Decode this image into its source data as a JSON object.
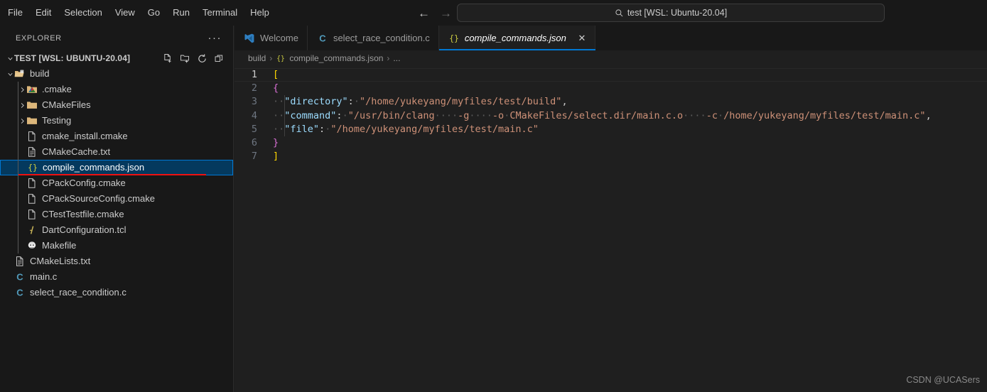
{
  "titlebar": {
    "menu": [
      "File",
      "Edit",
      "Selection",
      "View",
      "Go",
      "Run",
      "Terminal",
      "Help"
    ],
    "back_arrow": "←",
    "forward_arrow": "→",
    "command_center_text": "test [WSL: Ubuntu-20.04]",
    "search_icon": "search-icon"
  },
  "sidebar": {
    "title": "EXPLORER",
    "more_actions": "···",
    "root": {
      "label": "TEST [WSL: UBUNTU-20.04]",
      "expanded": true,
      "actions": [
        "new-file-icon",
        "new-folder-icon",
        "refresh-icon",
        "collapse-all-icon"
      ]
    },
    "tree": [
      {
        "label": "build",
        "icon": "folder-open-build",
        "indent": 1,
        "kind": "folder",
        "expanded": true,
        "selected": false
      },
      {
        "label": ".cmake",
        "icon": "folder-cmake",
        "indent": 2,
        "kind": "folder",
        "expanded": false,
        "selected": false
      },
      {
        "label": "CMakeFiles",
        "icon": "folder",
        "indent": 2,
        "kind": "folder",
        "expanded": false,
        "selected": false
      },
      {
        "label": "Testing",
        "icon": "folder",
        "indent": 2,
        "kind": "folder",
        "expanded": false,
        "selected": false
      },
      {
        "label": "cmake_install.cmake",
        "icon": "file-blank",
        "indent": 2,
        "kind": "file",
        "selected": false
      },
      {
        "label": "CMakeCache.txt",
        "icon": "file-text",
        "indent": 2,
        "kind": "file",
        "selected": false
      },
      {
        "label": "compile_commands.json",
        "icon": "json-braces",
        "indent": 2,
        "kind": "file",
        "selected": true
      },
      {
        "label": "CPackConfig.cmake",
        "icon": "file-blank",
        "indent": 2,
        "kind": "file",
        "selected": false
      },
      {
        "label": "CPackSourceConfig.cmake",
        "icon": "file-blank",
        "indent": 2,
        "kind": "file",
        "selected": false
      },
      {
        "label": "CTestTestfile.cmake",
        "icon": "file-blank",
        "indent": 2,
        "kind": "file",
        "selected": false
      },
      {
        "label": "DartConfiguration.tcl",
        "icon": "tcl-icon",
        "indent": 2,
        "kind": "file",
        "selected": false
      },
      {
        "label": "Makefile",
        "icon": "makefile-icon",
        "indent": 2,
        "kind": "file",
        "selected": false
      },
      {
        "label": "CMakeLists.txt",
        "icon": "file-text",
        "indent": 1,
        "kind": "file",
        "selected": false
      },
      {
        "label": "main.c",
        "icon": "c-file-icon",
        "indent": 1,
        "kind": "file",
        "selected": false
      },
      {
        "label": "select_race_condition.c",
        "icon": "c-file-icon",
        "indent": 1,
        "kind": "file",
        "selected": false
      }
    ]
  },
  "editor": {
    "tabs": [
      {
        "label": "Welcome",
        "icon": "vscode-logo-icon",
        "active": false,
        "closable": false
      },
      {
        "label": "select_race_condition.c",
        "icon": "c-file-icon",
        "active": false,
        "closable": false
      },
      {
        "label": "compile_commands.json",
        "icon": "json-braces",
        "active": true,
        "closable": true
      }
    ],
    "close_label": "✕",
    "breadcrumb": {
      "root": "build",
      "sep": "›",
      "file": "compile_commands.json",
      "tail": "..."
    },
    "lines": [
      {
        "n": "1",
        "active": true,
        "tokens": [
          {
            "t": "[",
            "c": "tok-brk-y"
          }
        ]
      },
      {
        "n": "2",
        "active": false,
        "tokens": [
          {
            "t": "{",
            "c": "tok-brk-p"
          }
        ]
      },
      {
        "n": "3",
        "active": false,
        "tokens": [
          {
            "t": "··",
            "c": "ws"
          },
          {
            "t": "\"directory\"",
            "c": "tok-key"
          },
          {
            "t": ":",
            "c": "tok-punc"
          },
          {
            "t": "·",
            "c": "ws"
          },
          {
            "t": "\"/home/yukeyang/myfiles/test/build\"",
            "c": "tok-str"
          },
          {
            "t": ",",
            "c": "tok-punc"
          }
        ]
      },
      {
        "n": "4",
        "active": false,
        "tokens": [
          {
            "t": "··",
            "c": "ws"
          },
          {
            "t": "\"command\"",
            "c": "tok-key"
          },
          {
            "t": ":",
            "c": "tok-punc"
          },
          {
            "t": "·",
            "c": "ws"
          },
          {
            "t": "\"/usr/bin/clang",
            "c": "tok-str"
          },
          {
            "t": "····",
            "c": "ws"
          },
          {
            "t": "-g",
            "c": "tok-str"
          },
          {
            "t": "····",
            "c": "ws"
          },
          {
            "t": "-o",
            "c": "tok-str"
          },
          {
            "t": "·",
            "c": "ws"
          },
          {
            "t": "CMakeFiles/select.dir/main.c.o",
            "c": "tok-str"
          },
          {
            "t": "····",
            "c": "ws"
          },
          {
            "t": "-c",
            "c": "tok-str"
          },
          {
            "t": "·",
            "c": "ws"
          },
          {
            "t": "/home/yukeyang/myfiles/test/main.c\"",
            "c": "tok-str"
          },
          {
            "t": ",",
            "c": "tok-punc"
          }
        ]
      },
      {
        "n": "5",
        "active": false,
        "tokens": [
          {
            "t": "··",
            "c": "ws"
          },
          {
            "t": "\"file\"",
            "c": "tok-key"
          },
          {
            "t": ":",
            "c": "tok-punc"
          },
          {
            "t": "·",
            "c": "ws"
          },
          {
            "t": "\"/home/yukeyang/myfiles/test/main.c\"",
            "c": "tok-str"
          }
        ]
      },
      {
        "n": "6",
        "active": false,
        "tokens": [
          {
            "t": "}",
            "c": "tok-brk-p"
          }
        ]
      },
      {
        "n": "7",
        "active": false,
        "tokens": [
          {
            "t": "]",
            "c": "tok-brk-y"
          }
        ]
      }
    ]
  },
  "watermark": "CSDN @UCASers",
  "colors": {
    "accent": "#0078d4",
    "selection_bg": "#04395e",
    "annotation_red": "#ee1111",
    "titlebar_bg": "#181818",
    "editor_bg": "#1f1f1f",
    "sidebar_bg": "#181818"
  }
}
